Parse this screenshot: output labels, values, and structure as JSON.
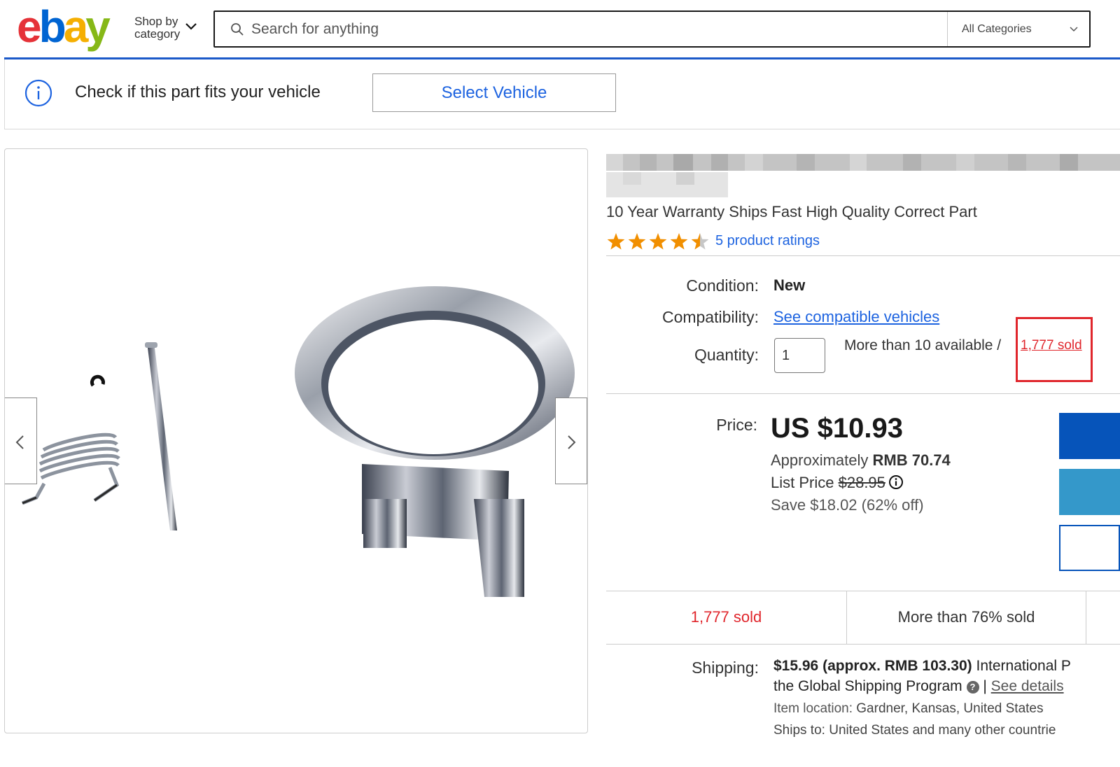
{
  "header": {
    "logo_text": "ebay",
    "shop_by_line1": "Shop by",
    "shop_by_line2": "category",
    "search_placeholder": "Search for anything",
    "category_select": "All Categories",
    "brand_colors": [
      "#e53238",
      "#0064d2",
      "#f5af02",
      "#86b817"
    ]
  },
  "vehicle_bar": {
    "message": "Check if this part fits your vehicle",
    "button_label": "Select Vehicle"
  },
  "listing": {
    "subtitle": "10 Year Warranty Ships Fast High Quality Correct Part",
    "rating_stars": 4.5,
    "ratings_link": "5 product ratings",
    "condition_label": "Condition:",
    "condition_value": "New",
    "compatibility_label": "Compatibility:",
    "compatibility_link": "See compatible vehicles",
    "quantity_label": "Quantity:",
    "quantity_value": "1",
    "availability": "More than 10 available /",
    "sold_link": "1,777 sold",
    "price_label": "Price:",
    "price": "US $10.93",
    "approx_prefix": "Approximately",
    "approx_value": "RMB 70.74",
    "list_price_label": "List Price",
    "list_price_value": "$28.95",
    "savings": "Save $18.02 (62% off)",
    "sold_count": "1,777 sold",
    "sold_percent": "More than 76% sold",
    "shipping_label": "Shipping:",
    "shipping_cost": "$15.96",
    "shipping_approx": "(approx.",
    "shipping_rmb": "RMB 103.30)",
    "shipping_method": "International P",
    "shipping_program": "the Global Shipping Program",
    "see_details": "See details",
    "item_location_label": "Item location:",
    "item_location": "Gardner, Kansas, United States",
    "ships_to_label": "Ships to:",
    "ships_to": "United States and many other countrie"
  },
  "colors": {
    "link_blue": "#1d63e0",
    "sold_red": "#e0262c",
    "buy_button": "#0654ba",
    "cart_button": "#3498ca",
    "header_rule": "#1b59c9",
    "star_orange": "#f18f00"
  }
}
